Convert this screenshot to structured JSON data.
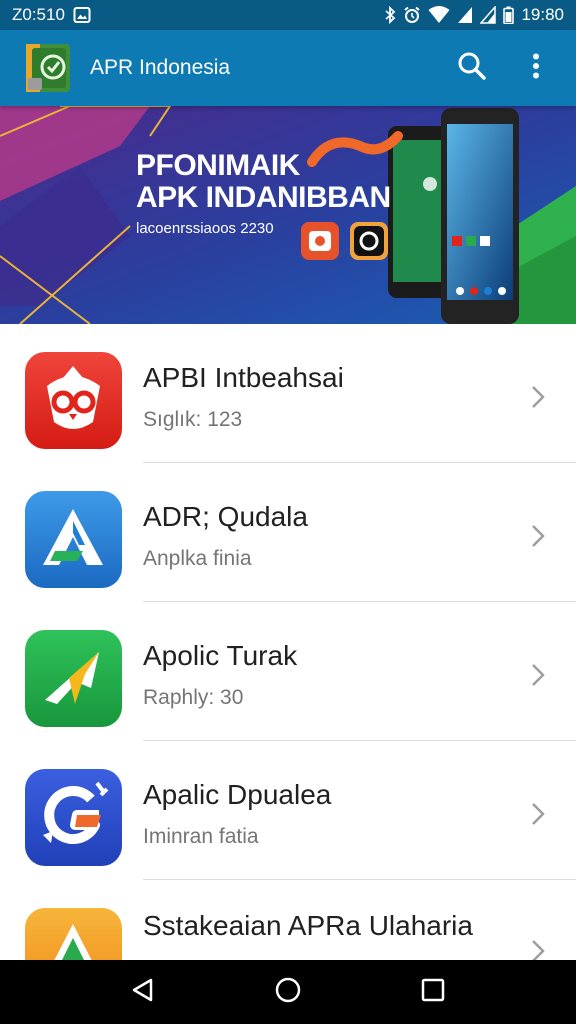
{
  "status_bar": {
    "time_left": "Z0:510",
    "time_right": "19:80",
    "icons": [
      "image-notification-icon",
      "bluetooth-icon",
      "alarm-icon",
      "wifi-icon",
      "signal-icon",
      "signal-icon",
      "battery-icon"
    ]
  },
  "app_bar": {
    "title": "APR Indonesia",
    "logo_icon": "app-logo-icon",
    "search_icon": "search-icon",
    "menu_icon": "more-vert-icon",
    "color": "#0d7ab4"
  },
  "banner": {
    "line1": "PFONIMAIK",
    "line2": "APK INDANIBBAN",
    "line3": "lacoenrssiaoos 2230"
  },
  "apps": [
    {
      "title": "APBI Intbeahsai",
      "subtitle": "Sıglık: 123",
      "icon": "owl-app-icon",
      "color": "#e2241b"
    },
    {
      "title": "ADR; Qudala",
      "subtitle": "Anplka finia",
      "icon": "triangle-a-app-icon",
      "color": "#1f7fd6"
    },
    {
      "title": "Apolic Turak",
      "subtitle": "Raphly: 30",
      "icon": "arrow-app-icon",
      "color": "#1faa4b"
    },
    {
      "title": "Apalic Dpualea",
      "subtitle": "Iminran fatia",
      "icon": "g-app-icon",
      "color": "#2b4fd0"
    },
    {
      "title": "Sstakeaian APRa Ulaharia",
      "subtitle": "",
      "icon": "triangle-orange-app-icon",
      "color": "#f5a31a"
    }
  ],
  "nav_bar": {
    "back_icon": "back-icon",
    "home_icon": "home-icon",
    "recents_icon": "recents-icon"
  }
}
